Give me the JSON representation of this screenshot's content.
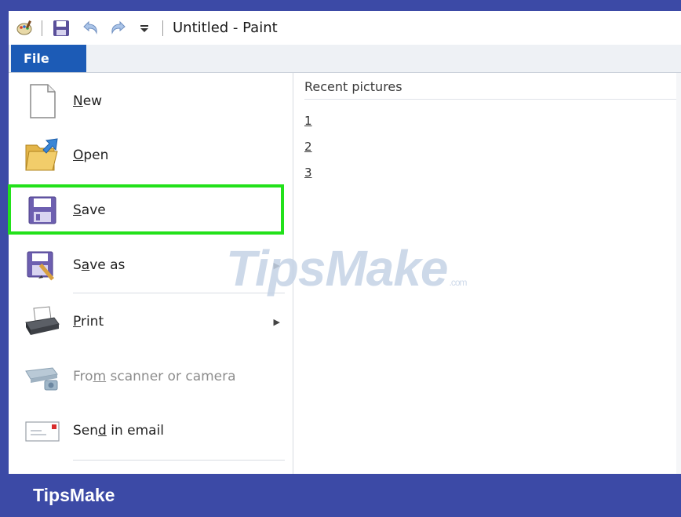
{
  "window": {
    "title": "Untitled - Paint"
  },
  "ribbon": {
    "file_tab": "File"
  },
  "menu": {
    "items": [
      {
        "id": "new",
        "label": "New",
        "mnemonic": "N",
        "icon": "new-document-icon",
        "enabled": true
      },
      {
        "id": "open",
        "label": "Open",
        "mnemonic": "O",
        "icon": "open-folder-icon",
        "enabled": true
      },
      {
        "id": "save",
        "label": "Save",
        "mnemonic": "S",
        "icon": "save-floppy-icon",
        "enabled": true,
        "highlighted": true
      },
      {
        "id": "save-as",
        "label": "Save as",
        "mnemonic": "a",
        "icon": "save-as-icon",
        "enabled": true,
        "submenu": true
      },
      {
        "id": "print",
        "label": "Print",
        "mnemonic": "P",
        "icon": "printer-icon",
        "enabled": true,
        "submenu": true
      },
      {
        "id": "scanner",
        "label": "From scanner or camera",
        "mnemonic": "m",
        "icon": "scanner-camera-icon",
        "enabled": false
      },
      {
        "id": "email",
        "label": "Send in email",
        "mnemonic": "d",
        "icon": "email-envelope-icon",
        "enabled": true
      }
    ]
  },
  "recent": {
    "title": "Recent pictures",
    "entries": [
      "1",
      "2",
      "3"
    ]
  },
  "watermark": {
    "text": "TipsMake",
    "suffix": ".com"
  },
  "footer": {
    "brand": "TipsMake"
  },
  "colors": {
    "frame": "#3c4aa6",
    "file_tab": "#1c5bb6",
    "highlight": "#22e11a"
  }
}
